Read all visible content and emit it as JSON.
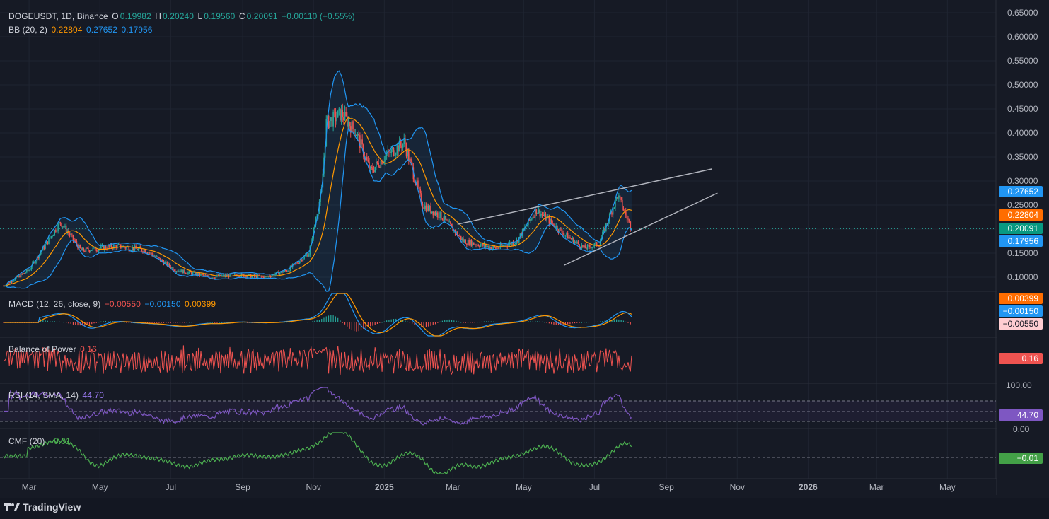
{
  "symbol_line": {
    "title": "DOGEUSDT, 1D, Binance",
    "o_label": "O",
    "o_value": "0.19982",
    "h_label": "H",
    "h_value": "0.20240",
    "l_label": "L",
    "l_value": "0.19560",
    "c_label": "C",
    "c_value": "0.20091",
    "change": "+0.00110 (+0.55%)"
  },
  "bb_line": {
    "label": "BB (20, 2)",
    "basis": "0.22804",
    "upper": "0.27652",
    "lower": "0.17956"
  },
  "macd_line": {
    "label": "MACD (12, 26, close, 9)",
    "hist": "−0.00550",
    "macd": "−0.00150",
    "signal": "0.00399"
  },
  "bop_line": {
    "label": "Balance of Power",
    "value": "0.16"
  },
  "rsi_line": {
    "label": "RSI (14, SMA, 14)",
    "value": "44.70"
  },
  "cmf_line": {
    "label": "CMF (20)",
    "value": "−0.01"
  },
  "brand": "TradingView",
  "colors": {
    "background": "#161a25",
    "up": "#26a69a",
    "down": "#ef5350",
    "bb_basis": "#ff9800",
    "bb_band": "#2196f3",
    "macd": "#2196f3",
    "signal": "#ff9800",
    "bop": "#ef5350",
    "rsi": "#7e57c2",
    "cmf": "#4caf50",
    "trendline": "#b2b5be"
  },
  "chart_data": {
    "type": "line",
    "title": "DOGEUSDT, 1D, Binance",
    "x_tick_labels": [
      "Mar",
      "May",
      "Jul",
      "Sep",
      "Nov",
      "2025",
      "Mar",
      "May",
      "Jul",
      "Sep",
      "Nov",
      "2026",
      "Mar",
      "May"
    ],
    "y_tick_labels": [
      "0.65000",
      "0.60000",
      "0.55000",
      "0.50000",
      "0.45000",
      "0.40000",
      "0.35000",
      "0.30000",
      "0.25000",
      "0.20000",
      "0.15000",
      "0.10000"
    ],
    "ylim": [
      0.07,
      0.66
    ],
    "price_series": {
      "name": "DOGEUSDT",
      "x": [
        "2024-02-08",
        "2024-03-01",
        "2024-03-28",
        "2024-04-15",
        "2024-05-15",
        "2024-06-10",
        "2024-07-05",
        "2024-08-05",
        "2024-08-25",
        "2024-09-20",
        "2024-10-10",
        "2024-10-28",
        "2024-11-08",
        "2024-11-12",
        "2024-11-25",
        "2024-12-08",
        "2024-12-20",
        "2025-01-01",
        "2025-01-18",
        "2025-02-03",
        "2025-02-20",
        "2025-03-10",
        "2025-04-07",
        "2025-04-25",
        "2025-05-12",
        "2025-06-05",
        "2025-06-22",
        "2025-07-05",
        "2025-07-21",
        "2025-08-02"
      ],
      "close": [
        0.082,
        0.115,
        0.215,
        0.155,
        0.165,
        0.155,
        0.115,
        0.1,
        0.105,
        0.1,
        0.115,
        0.15,
        0.28,
        0.42,
        0.44,
        0.4,
        0.32,
        0.35,
        0.38,
        0.25,
        0.225,
        0.175,
        0.16,
        0.175,
        0.24,
        0.19,
        0.16,
        0.17,
        0.27,
        0.2009
      ]
    },
    "series": [
      {
        "name": "BB basis",
        "last": 0.22804
      },
      {
        "name": "BB upper",
        "last": 0.27652
      },
      {
        "name": "BB lower",
        "last": 0.17956
      }
    ],
    "trendlines": [
      {
        "name": "upper",
        "from": [
          "2025-03-05",
          0.21
        ],
        "to": [
          "2025-10-10",
          0.325
        ]
      },
      {
        "name": "lower",
        "from": [
          "2025-06-05",
          0.125
        ],
        "to": [
          "2025-10-15",
          0.275
        ]
      }
    ],
    "last_price": 0.20091,
    "indicators": {
      "macd": {
        "params": "12, 26, close, 9",
        "histogram": -0.0055,
        "macd": -0.0015,
        "signal": 0.00399
      },
      "bop": {
        "value": 0.16
      },
      "rsi": {
        "params": "14, SMA, 14",
        "value": 44.7,
        "tick_labels": [
          "100.00",
          "0.00"
        ]
      },
      "cmf": {
        "params": "20",
        "value": -0.01
      }
    },
    "grid": true
  }
}
